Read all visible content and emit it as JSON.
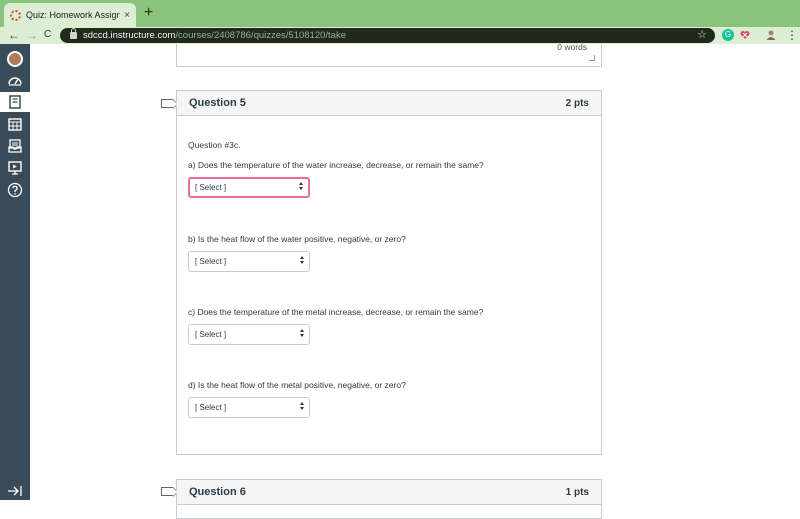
{
  "browser": {
    "tab_title": "Quiz: Homework Assignment #",
    "tab_close": "×",
    "new_tab": "+",
    "back": "←",
    "forward": "→",
    "reload": "C",
    "url_host": "sdccd.instructure.com",
    "url_path": "/courses/2408786/quizzes/5108120/take",
    "star": "☆",
    "ext_grammarly": "G",
    "menu": "⋮"
  },
  "sidebar": {
    "items": [
      "account",
      "dashboard",
      "courses",
      "calendar",
      "inbox",
      "commons",
      "help"
    ],
    "active": "courses"
  },
  "previous_answer": {
    "word_count": "0 words"
  },
  "question5": {
    "title": "Question 5",
    "points": "2 pts",
    "intro": "Question #3c.",
    "parts": [
      {
        "prompt": "a)  Does the temperature of the water increase, decrease, or remain the same?",
        "selected": "[ Select ]"
      },
      {
        "prompt": "b)  Is the heat flow of the water positive, negative, or zero?",
        "selected": "[ Select ]"
      },
      {
        "prompt": "c)  Does the temperature of the metal increase, decrease, or remain the same?",
        "selected": "[ Select ]"
      },
      {
        "prompt": "d)  Is the heat flow of the metal positive, negative, or zero?",
        "selected": "[ Select ]"
      }
    ]
  },
  "question6": {
    "title": "Question 6",
    "points": "1 pts"
  },
  "colors": {
    "sidebar_bg": "#394b58",
    "focus_ring": "#e66d9f",
    "tab_strip": "#8bc37c"
  }
}
